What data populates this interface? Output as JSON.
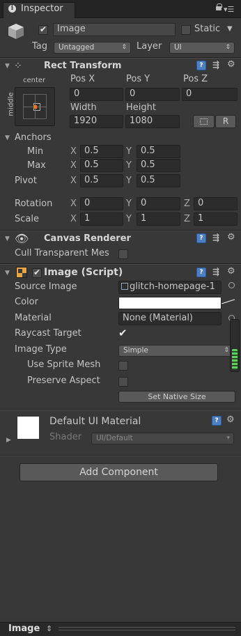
{
  "window": {
    "tab_label": "Inspector",
    "tab_icon": "info-icon",
    "menu_icon": "kebab-menu-icon"
  },
  "gameobject": {
    "active": true,
    "name": "Image",
    "static_label": "Static",
    "static_checked": false,
    "tag_label": "Tag",
    "tag_value": "Untagged",
    "layer_label": "Layer",
    "layer_value": "UI"
  },
  "rect_transform": {
    "title": "Rect Transform",
    "anchor_top": "center",
    "anchor_side": "middle",
    "pos_x_label": "Pos X",
    "pos_y_label": "Pos Y",
    "pos_z_label": "Pos Z",
    "pos_x": "0",
    "pos_y": "0",
    "pos_z": "0",
    "width_label": "Width",
    "height_label": "Height",
    "width": "1920",
    "height": "1080",
    "raw_button": "R",
    "anchors_label": "Anchors",
    "min_label": "Min",
    "max_label": "Max",
    "pivot_label": "Pivot",
    "x": "X",
    "y": "Y",
    "z": "Z",
    "min_x": "0.5",
    "min_y": "0.5",
    "max_x": "0.5",
    "max_y": "0.5",
    "pivot_x": "0.5",
    "pivot_y": "0.5",
    "rotation_label": "Rotation",
    "rot_x": "0",
    "rot_y": "0",
    "rot_z": "0",
    "scale_label": "Scale",
    "scale_x": "1",
    "scale_y": "1",
    "scale_z": "1"
  },
  "canvas_renderer": {
    "title": "Canvas Renderer",
    "cull_label": "Cull Transparent Mes",
    "cull_checked": false
  },
  "image_script": {
    "title": "Image (Script)",
    "enabled": true,
    "source_image_label": "Source Image",
    "source_image_value": "glitch-homepage-1",
    "color_label": "Color",
    "color_value": "#ffffff",
    "material_label": "Material",
    "material_value": "None (Material)",
    "raycast_label": "Raycast Target",
    "raycast_checked": true,
    "image_type_label": "Image Type",
    "image_type_value": "Simple",
    "sprite_mesh_label": "Use Sprite Mesh",
    "sprite_mesh_checked": false,
    "preserve_label": "Preserve Aspect",
    "preserve_checked": false,
    "native_size_button": "Set Native Size"
  },
  "material": {
    "name": "Default UI Material",
    "shader_label": "Shader",
    "shader_value": "UI/Default"
  },
  "add_component": "Add Component",
  "footer": {
    "label": "Image"
  }
}
